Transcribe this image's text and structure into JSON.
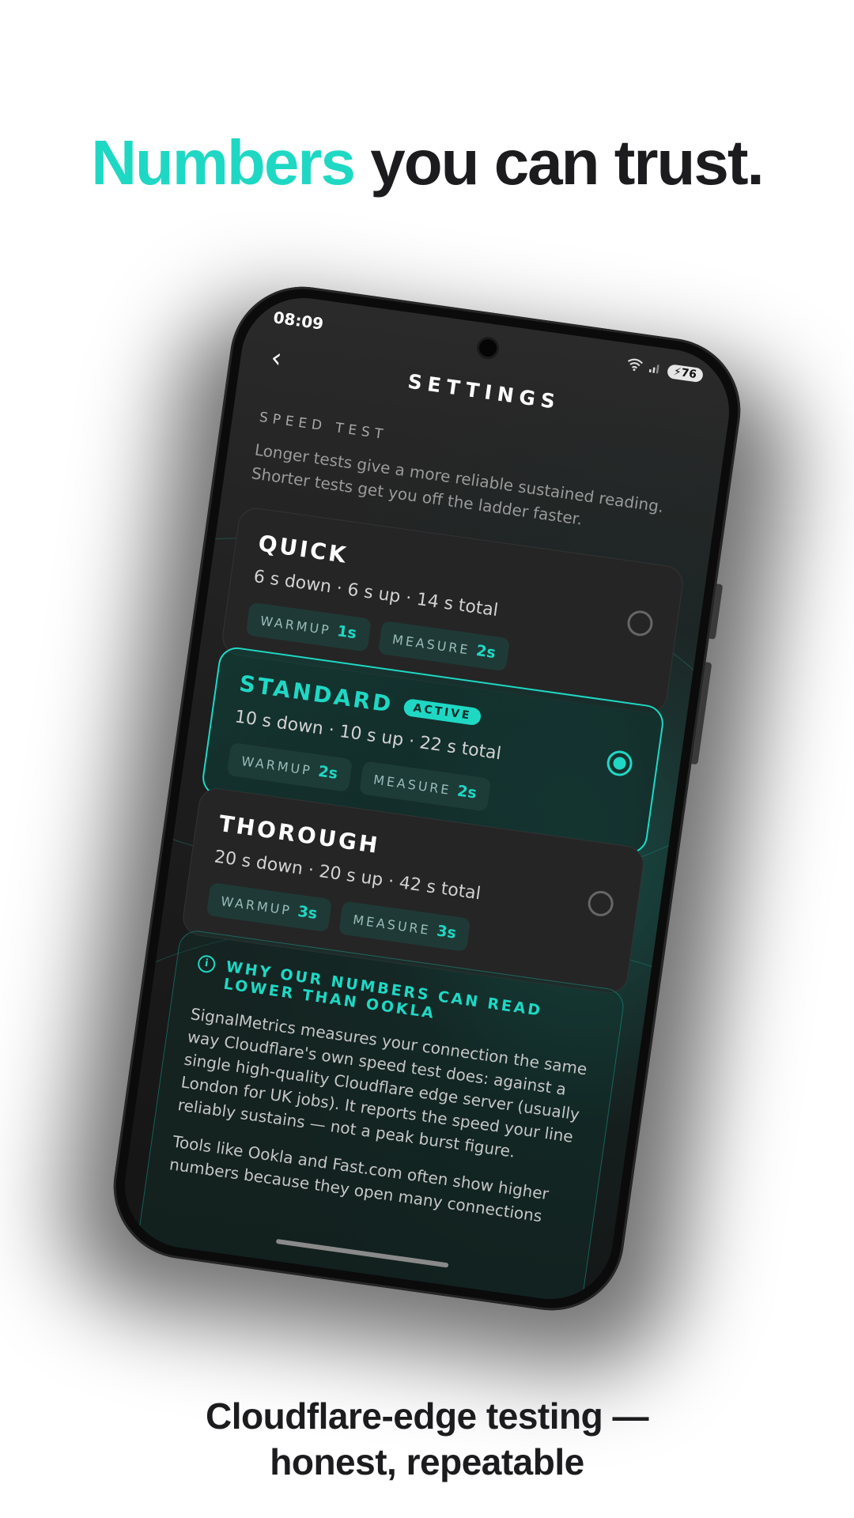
{
  "headline": {
    "accent": "Numbers",
    "rest": "you can trust."
  },
  "caption": {
    "line1": "Cloudflare-edge testing —",
    "line2": "honest, repeatable"
  },
  "status_bar": {
    "time": "08:09",
    "battery": "76"
  },
  "header": {
    "title": "SETTINGS"
  },
  "section": {
    "label": "SPEED TEST",
    "description": "Longer tests give a more reliable sustained reading. Shorter tests get you off the ladder faster."
  },
  "options": [
    {
      "name": "QUICK",
      "summary": "6 s down · 6 s up · 14 s total",
      "warmup_label": "WARMUP",
      "warmup_value": "1s",
      "measure_label": "MEASURE",
      "measure_value": "2s",
      "selected": false
    },
    {
      "name": "STANDARD",
      "badge": "ACTIVE",
      "summary": "10 s down · 10 s up · 22 s total",
      "warmup_label": "WARMUP",
      "warmup_value": "2s",
      "measure_label": "MEASURE",
      "measure_value": "2s",
      "selected": true
    },
    {
      "name": "THOROUGH",
      "summary": "20 s down · 20 s up · 42 s total",
      "warmup_label": "WARMUP",
      "warmup_value": "3s",
      "measure_label": "MEASURE",
      "measure_value": "3s",
      "selected": false
    }
  ],
  "info": {
    "icon": "i",
    "title": "WHY OUR NUMBERS CAN READ LOWER THAN OOKLA",
    "p1": "SignalMetrics measures your connection the same way Cloudflare's own speed test does: against a single high-quality Cloudflare edge server (usually London for UK jobs). It reports the speed your line reliably sustains — not a peak burst figure.",
    "p2": "Tools like Ookla and Fast.com often show higher numbers because they open many connections"
  },
  "colors": {
    "accent": "#1fd8c4",
    "background": "#ffffff",
    "screen": "#1e1e1e"
  }
}
